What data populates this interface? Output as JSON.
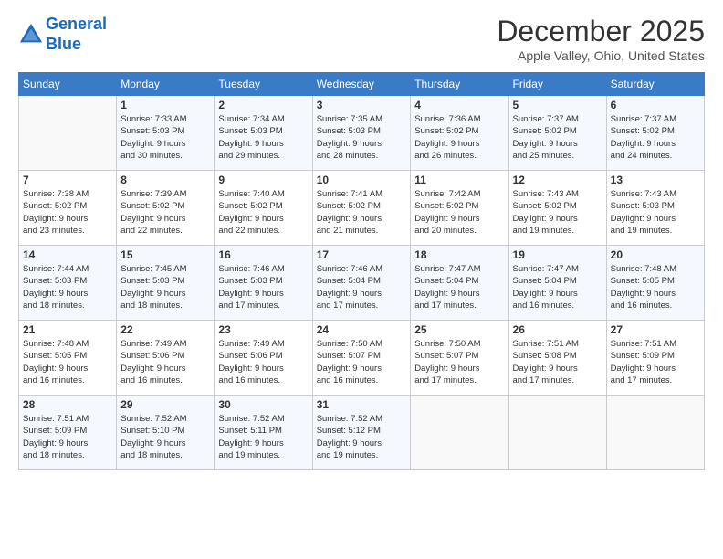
{
  "header": {
    "logo_line1": "General",
    "logo_line2": "Blue",
    "month": "December 2025",
    "location": "Apple Valley, Ohio, United States"
  },
  "weekdays": [
    "Sunday",
    "Monday",
    "Tuesday",
    "Wednesday",
    "Thursday",
    "Friday",
    "Saturday"
  ],
  "weeks": [
    [
      {
        "day": "",
        "info": ""
      },
      {
        "day": "1",
        "info": "Sunrise: 7:33 AM\nSunset: 5:03 PM\nDaylight: 9 hours\nand 30 minutes."
      },
      {
        "day": "2",
        "info": "Sunrise: 7:34 AM\nSunset: 5:03 PM\nDaylight: 9 hours\nand 29 minutes."
      },
      {
        "day": "3",
        "info": "Sunrise: 7:35 AM\nSunset: 5:03 PM\nDaylight: 9 hours\nand 28 minutes."
      },
      {
        "day": "4",
        "info": "Sunrise: 7:36 AM\nSunset: 5:02 PM\nDaylight: 9 hours\nand 26 minutes."
      },
      {
        "day": "5",
        "info": "Sunrise: 7:37 AM\nSunset: 5:02 PM\nDaylight: 9 hours\nand 25 minutes."
      },
      {
        "day": "6",
        "info": "Sunrise: 7:37 AM\nSunset: 5:02 PM\nDaylight: 9 hours\nand 24 minutes."
      }
    ],
    [
      {
        "day": "7",
        "info": "Sunrise: 7:38 AM\nSunset: 5:02 PM\nDaylight: 9 hours\nand 23 minutes."
      },
      {
        "day": "8",
        "info": "Sunrise: 7:39 AM\nSunset: 5:02 PM\nDaylight: 9 hours\nand 22 minutes."
      },
      {
        "day": "9",
        "info": "Sunrise: 7:40 AM\nSunset: 5:02 PM\nDaylight: 9 hours\nand 22 minutes."
      },
      {
        "day": "10",
        "info": "Sunrise: 7:41 AM\nSunset: 5:02 PM\nDaylight: 9 hours\nand 21 minutes."
      },
      {
        "day": "11",
        "info": "Sunrise: 7:42 AM\nSunset: 5:02 PM\nDaylight: 9 hours\nand 20 minutes."
      },
      {
        "day": "12",
        "info": "Sunrise: 7:43 AM\nSunset: 5:02 PM\nDaylight: 9 hours\nand 19 minutes."
      },
      {
        "day": "13",
        "info": "Sunrise: 7:43 AM\nSunset: 5:03 PM\nDaylight: 9 hours\nand 19 minutes."
      }
    ],
    [
      {
        "day": "14",
        "info": "Sunrise: 7:44 AM\nSunset: 5:03 PM\nDaylight: 9 hours\nand 18 minutes."
      },
      {
        "day": "15",
        "info": "Sunrise: 7:45 AM\nSunset: 5:03 PM\nDaylight: 9 hours\nand 18 minutes."
      },
      {
        "day": "16",
        "info": "Sunrise: 7:46 AM\nSunset: 5:03 PM\nDaylight: 9 hours\nand 17 minutes."
      },
      {
        "day": "17",
        "info": "Sunrise: 7:46 AM\nSunset: 5:04 PM\nDaylight: 9 hours\nand 17 minutes."
      },
      {
        "day": "18",
        "info": "Sunrise: 7:47 AM\nSunset: 5:04 PM\nDaylight: 9 hours\nand 17 minutes."
      },
      {
        "day": "19",
        "info": "Sunrise: 7:47 AM\nSunset: 5:04 PM\nDaylight: 9 hours\nand 16 minutes."
      },
      {
        "day": "20",
        "info": "Sunrise: 7:48 AM\nSunset: 5:05 PM\nDaylight: 9 hours\nand 16 minutes."
      }
    ],
    [
      {
        "day": "21",
        "info": "Sunrise: 7:48 AM\nSunset: 5:05 PM\nDaylight: 9 hours\nand 16 minutes."
      },
      {
        "day": "22",
        "info": "Sunrise: 7:49 AM\nSunset: 5:06 PM\nDaylight: 9 hours\nand 16 minutes."
      },
      {
        "day": "23",
        "info": "Sunrise: 7:49 AM\nSunset: 5:06 PM\nDaylight: 9 hours\nand 16 minutes."
      },
      {
        "day": "24",
        "info": "Sunrise: 7:50 AM\nSunset: 5:07 PM\nDaylight: 9 hours\nand 16 minutes."
      },
      {
        "day": "25",
        "info": "Sunrise: 7:50 AM\nSunset: 5:07 PM\nDaylight: 9 hours\nand 17 minutes."
      },
      {
        "day": "26",
        "info": "Sunrise: 7:51 AM\nSunset: 5:08 PM\nDaylight: 9 hours\nand 17 minutes."
      },
      {
        "day": "27",
        "info": "Sunrise: 7:51 AM\nSunset: 5:09 PM\nDaylight: 9 hours\nand 17 minutes."
      }
    ],
    [
      {
        "day": "28",
        "info": "Sunrise: 7:51 AM\nSunset: 5:09 PM\nDaylight: 9 hours\nand 18 minutes."
      },
      {
        "day": "29",
        "info": "Sunrise: 7:52 AM\nSunset: 5:10 PM\nDaylight: 9 hours\nand 18 minutes."
      },
      {
        "day": "30",
        "info": "Sunrise: 7:52 AM\nSunset: 5:11 PM\nDaylight: 9 hours\nand 19 minutes."
      },
      {
        "day": "31",
        "info": "Sunrise: 7:52 AM\nSunset: 5:12 PM\nDaylight: 9 hours\nand 19 minutes."
      },
      {
        "day": "",
        "info": ""
      },
      {
        "day": "",
        "info": ""
      },
      {
        "day": "",
        "info": ""
      }
    ]
  ]
}
